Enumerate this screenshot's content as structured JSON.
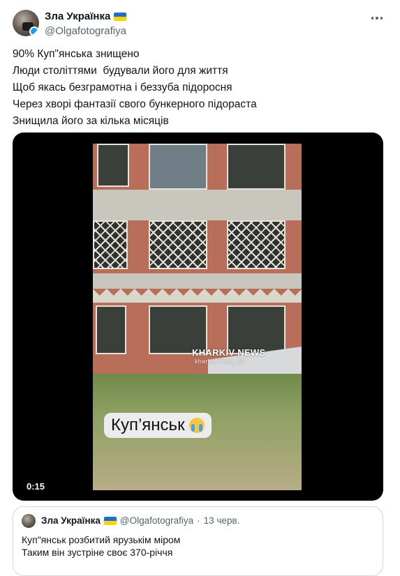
{
  "author": {
    "display_name": "Зла Українка",
    "handle": "@Olgafotografiya"
  },
  "tweet": {
    "lines": [
      "90% Куп\"янська знищено",
      "Люди століттями  будували його для життя",
      "Щоб якась безграмотна і беззуба підоросня",
      "Через хворі фантазії свого бункерного підораста",
      "Знищила його за кілька місяців"
    ]
  },
  "video": {
    "watermark": "KHARKIV NEWS",
    "watermark_sub": "kharkiv.news_24",
    "caption": "Куп’янськ",
    "caption_emoji": "crying-face",
    "timestamp": "0:15"
  },
  "quote": {
    "display_name": "Зла Українка",
    "handle": "@Olgafotografiya",
    "separator": "·",
    "date": "13 черв.",
    "lines": [
      "Куп\"янськ розбитий ярузькім міром",
      "Таким він зустріне своє 370-річчя"
    ]
  },
  "colors": {
    "text_primary": "#0f1419",
    "text_secondary": "#536471",
    "border": "#cfd9de",
    "flag_blue": "#1f6fd1",
    "flag_yellow": "#ffd500"
  }
}
